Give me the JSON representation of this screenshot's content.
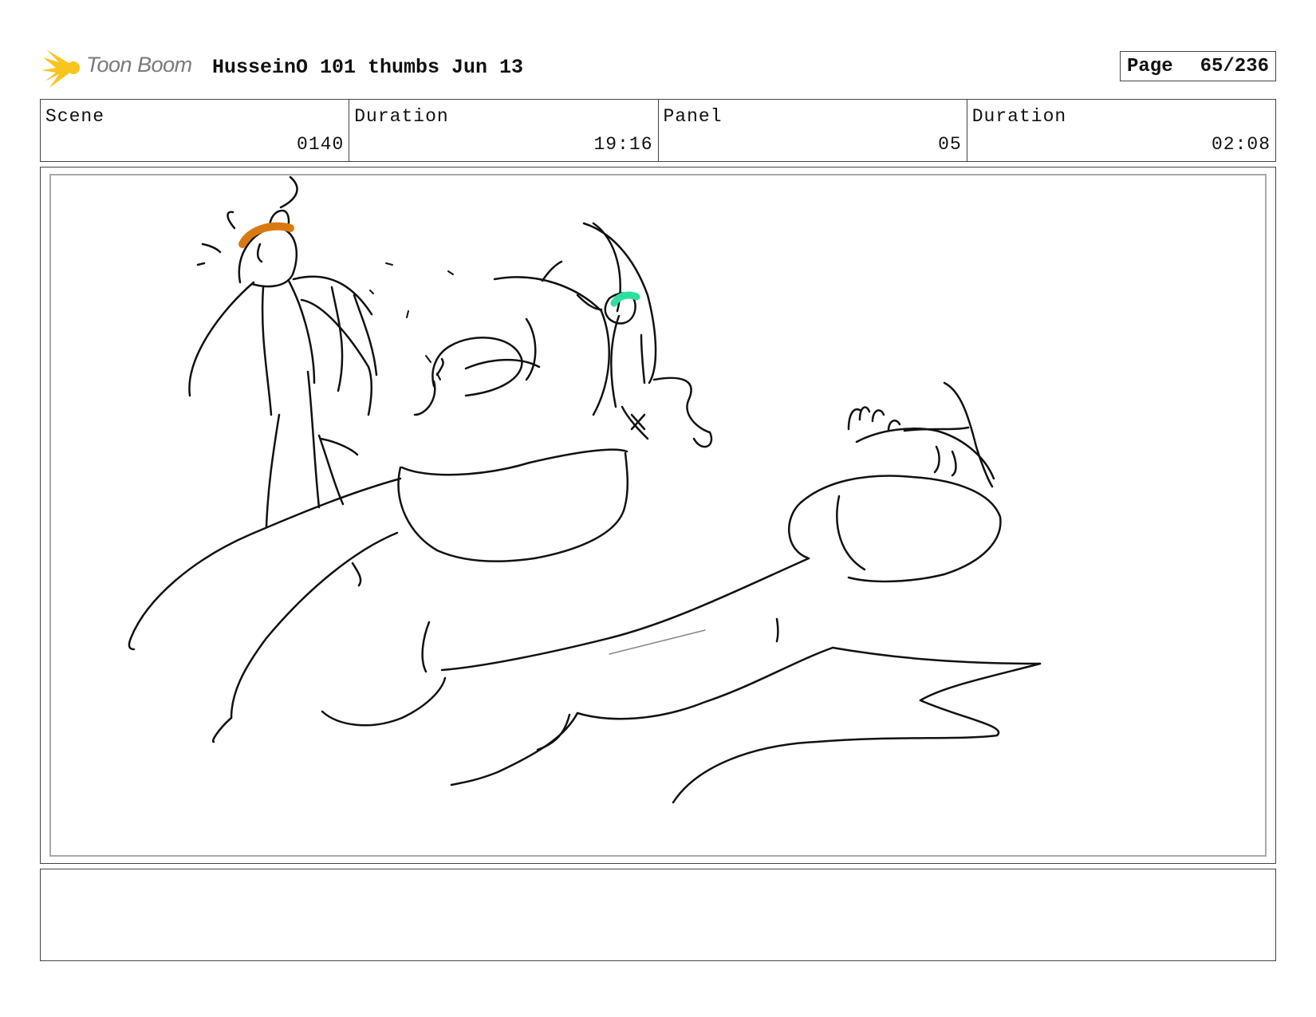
{
  "header": {
    "brand": "Toon Boom",
    "title": "HusseinO 101 thumbs Jun 13",
    "page_label": "Page",
    "page_value": "65/236"
  },
  "info": {
    "scene_label": "Scene",
    "scene_value": "0140",
    "duration_label": "Duration",
    "duration_value": "19:16",
    "panel_label": "Panel",
    "panel_value": "05",
    "panel_duration_label": "Duration",
    "panel_duration_value": "02:08"
  },
  "colors": {
    "logo": "#f7c51e",
    "headband": "#d97a10",
    "accent_green": "#2ee0a0",
    "ink": "#111111"
  },
  "notes": {
    "text": ""
  }
}
